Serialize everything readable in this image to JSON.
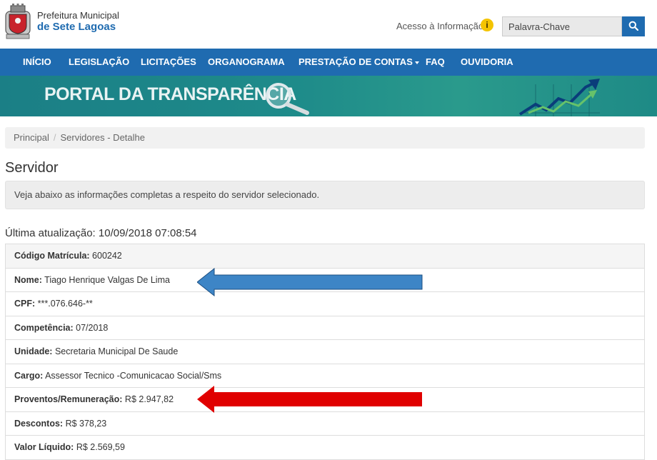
{
  "header": {
    "org_line1": "Prefeitura Municipal",
    "org_line2": "de Sete Lagoas",
    "access_info": "Acesso à Informação",
    "search_placeholder": "Palavra-Chave"
  },
  "nav": {
    "items": [
      "INÍCIO",
      "LEGISLAÇÃO",
      "LICITAÇÕES",
      "ORGANOGRAMA",
      "PRESTAÇÃO DE CONTAS",
      "FAQ",
      "OUVIDORIA"
    ]
  },
  "banner": {
    "title": "PORTAL DA TRANSPARÊNCIA"
  },
  "breadcrumb": {
    "home": "Principal",
    "current": "Servidores - Detalhe"
  },
  "page": {
    "title": "Servidor",
    "alert": "Veja abaixo as informações completas a respeito do servidor selecionado.",
    "updated": "Última atualização: 10/09/2018 07:08:54"
  },
  "details": [
    {
      "label": "Código Matrícula:",
      "value": "600242"
    },
    {
      "label": "Nome:",
      "value": "Tiago Henrique Valgas De Lima"
    },
    {
      "label": "CPF:",
      "value": "***.076.646-**"
    },
    {
      "label": "Competência:",
      "value": "07/2018"
    },
    {
      "label": "Unidade:",
      "value": "Secretaria Municipal De Saude"
    },
    {
      "label": "Cargo:",
      "value": "Assessor Tecnico -Comunicacao Social/Sms"
    },
    {
      "label": "Proventos/Remuneração:",
      "value": "R$ 2.947,82"
    },
    {
      "label": "Descontos:",
      "value": "R$ 378,23"
    },
    {
      "label": "Valor Líquido:",
      "value": "R$ 2.569,59"
    }
  ],
  "colors": {
    "brand": "#1f6bb0",
    "banner": "#1e8b8a",
    "arrow_blue": "#3d85c6",
    "arrow_red": "#e00000"
  },
  "icons": {
    "info": "info-icon",
    "search": "search-icon",
    "logo": "coat-of-arms-logo"
  }
}
